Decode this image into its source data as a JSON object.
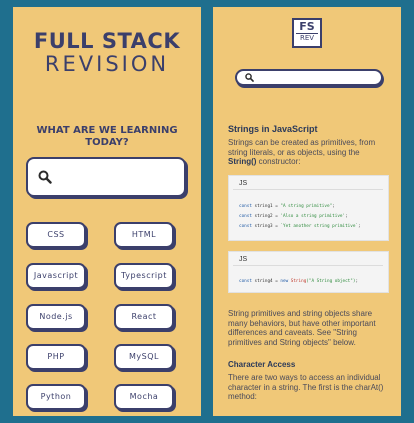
{
  "home": {
    "title_line1": "FULL STACK",
    "title_line2": "REVISION",
    "question": "WHAT ARE WE LEARNING TODAY?",
    "search_icon": "search-icon",
    "topics": [
      "CSS",
      "HTML",
      "Javascript",
      "Typescript",
      "Node.js",
      "React",
      "PHP",
      "MySQL",
      "Python",
      "Mocha"
    ]
  },
  "article": {
    "logo_top": "FS",
    "logo_bottom": "REV",
    "search_icon": "search-icon",
    "heading": "Strings in JavaScript",
    "intro_before": "Strings can be created as primitives, from string literals, or as objects, using the ",
    "intro_code": "String()",
    "intro_after": " constructor:",
    "code1": {
      "lang": "JS",
      "lines": [
        {
          "kw": "const",
          "name": " string1 = ",
          "str": "\"A string primitive\"",
          "end": ";"
        },
        {
          "kw": "const",
          "name": " string2 = ",
          "str": "'Also a string primitive'",
          "end": ";"
        },
        {
          "kw": "const",
          "name": " string3 = ",
          "str": "`Yet another string primitive`",
          "end": ";"
        }
      ]
    },
    "code2": {
      "lang": "JS",
      "line": {
        "kw": "const",
        "name": " string4 = ",
        "kw2": "new",
        "fn": " String",
        "str": "(\"A String object\")",
        "end": ";"
      }
    },
    "para2": "String primitives and string objects share many behaviors, but have other important differences and caveats. See \"String primitives and String objects\" below.",
    "heading2": "Character Access",
    "para3": "There are two ways to access an individual character in a string. The first is the charAt() method:"
  },
  "colors": {
    "background": "#1f6f8e",
    "panel": "#f0c878",
    "ink": "#3b3f6b"
  }
}
